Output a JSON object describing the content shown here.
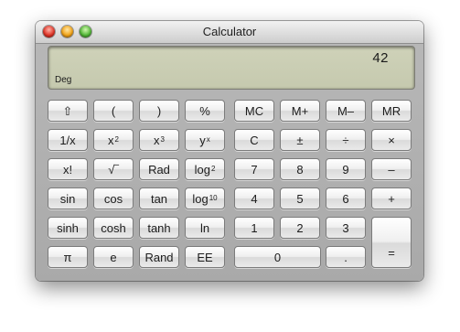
{
  "window": {
    "title": "Calculator"
  },
  "display": {
    "value": "42",
    "mode": "Deg"
  },
  "buttons": {
    "shift": "⇧",
    "lparen": "(",
    "rparen": ")",
    "percent": "%",
    "mc": "MC",
    "mplus": "M+",
    "mminus": "M–",
    "mr": "MR",
    "recip": "1/x",
    "x2_base": "x",
    "x2_exp": "2",
    "x3_base": "x",
    "x3_exp": "3",
    "yx_base": "y",
    "yx_exp": "x",
    "clear": "C",
    "plusminus": "±",
    "divide": "÷",
    "multiply": "×",
    "fact": "x!",
    "sqrt": "√‾",
    "rad": "Rad",
    "log2_base": "log",
    "log2_sub": "2",
    "seven": "7",
    "eight": "8",
    "nine": "9",
    "minus": "–",
    "sin": "sin",
    "cos": "cos",
    "tan": "tan",
    "log10_base": "log",
    "log10_sub": "10",
    "four": "4",
    "five": "5",
    "six": "6",
    "plus": "+",
    "sinh": "sinh",
    "cosh": "cosh",
    "tanh": "tanh",
    "ln": "ln",
    "one": "1",
    "two": "2",
    "three": "3",
    "equals": "=",
    "pi": "π",
    "e": "e",
    "rand": "Rand",
    "ee": "EE",
    "zero": "0",
    "dot": "."
  }
}
